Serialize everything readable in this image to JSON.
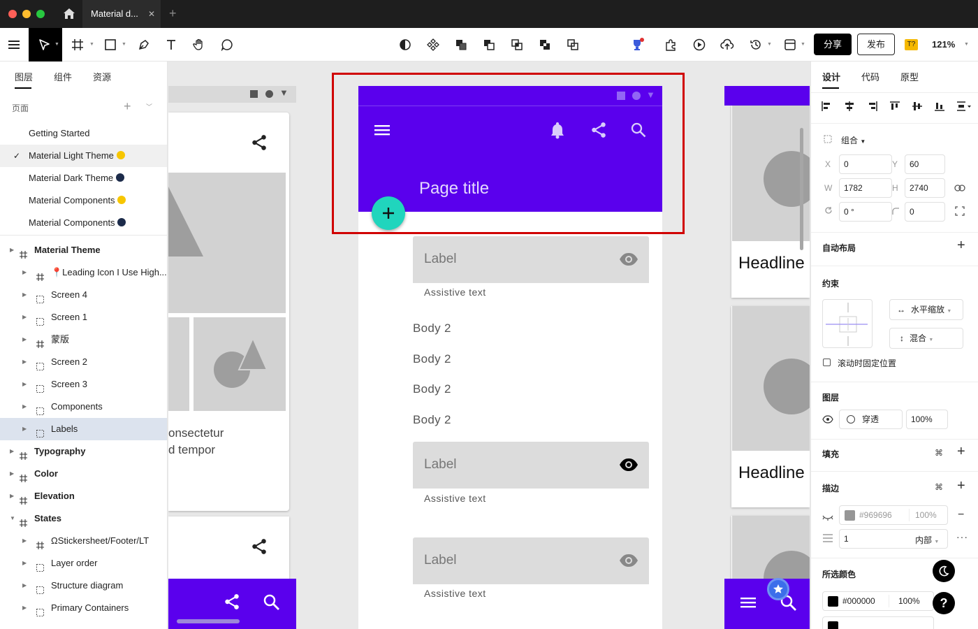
{
  "window": {
    "tab_title": "Material d...",
    "tab_close": "✕",
    "new_tab": "+"
  },
  "toolbar": {
    "share": "分享",
    "publish": "发布",
    "badge": "T?",
    "zoom": "121%"
  },
  "left_panel": {
    "tabs": [
      "图层",
      "组件",
      "资源"
    ],
    "pages_title": "页面",
    "pages": [
      {
        "label": "Getting Started",
        "selected": false
      },
      {
        "label": "Material Light Theme",
        "selected": true,
        "emoji": "🌕"
      },
      {
        "label": "Material Dark Theme",
        "selected": false,
        "emoji": "🌑"
      },
      {
        "label": "Material Components",
        "selected": false,
        "emoji": "🌕"
      },
      {
        "label": "Material Components",
        "selected": false,
        "emoji": "🌑"
      }
    ],
    "layers": [
      {
        "label": "Material Theme",
        "level": 0,
        "type": "frame",
        "bold": true
      },
      {
        "label": "📍Leading Icon I Use High...",
        "level": 1,
        "type": "frame"
      },
      {
        "label": "Screen 4",
        "level": 1,
        "type": "component"
      },
      {
        "label": "Screen 1",
        "level": 1,
        "type": "component"
      },
      {
        "label": "蒙版",
        "level": 1,
        "type": "frame"
      },
      {
        "label": "Screen 2",
        "level": 1,
        "type": "component"
      },
      {
        "label": "Screen 3",
        "level": 1,
        "type": "component"
      },
      {
        "label": "Components",
        "level": 1,
        "type": "component"
      },
      {
        "label": "Labels",
        "level": 1,
        "type": "component",
        "highlighted": true
      },
      {
        "label": "Typography",
        "level": 0,
        "type": "frame",
        "bold": true
      },
      {
        "label": "Color",
        "level": 0,
        "type": "frame",
        "bold": true
      },
      {
        "label": "Elevation",
        "level": 0,
        "type": "frame",
        "bold": true
      },
      {
        "label": "States",
        "level": 0,
        "type": "frame",
        "bold": true,
        "expanded": true
      },
      {
        "label": "ΩStickersheet/Footer/LT",
        "level": 1,
        "type": "frame"
      },
      {
        "label": "Layer order",
        "level": 1,
        "type": "component"
      },
      {
        "label": "Structure diagram",
        "level": 1,
        "type": "component"
      },
      {
        "label": "Primary Containers",
        "level": 1,
        "type": "component"
      }
    ]
  },
  "canvas": {
    "left_card_text": [
      "onsectetur",
      "d tempor"
    ],
    "center": {
      "page_title": "Page title",
      "fields": [
        {
          "label": "Label",
          "assistive": "Assistive text"
        },
        {
          "label": "Label",
          "assistive": "Assistive text"
        },
        {
          "label": "Label",
          "assistive": "Assistive text"
        }
      ],
      "body": [
        "Body 2",
        "Body 2",
        "Body 2",
        "Body 2"
      ]
    },
    "right_headlines": [
      "Headline",
      "Headline"
    ],
    "colors": {
      "primary": "#5a00ed",
      "fab": "#20d5bd",
      "selection": "#d00000"
    }
  },
  "right_panel": {
    "tabs": [
      "设计",
      "代码",
      "原型"
    ],
    "group_label": "组合",
    "x_label": "X",
    "x": "0",
    "y_label": "Y",
    "y": "60",
    "w_label": "W",
    "w": "1782",
    "h_label": "H",
    "h": "2740",
    "rotation": "0 °",
    "radius": "0",
    "auto_layout": "自动布局",
    "constraints": "约束",
    "h_constraint": "水平缩放",
    "v_constraint": "混合",
    "fix_on_scroll": "滚动时固定位置",
    "layer": "图层",
    "blend": "穿透",
    "opacity": "100%",
    "fill": "填充",
    "stroke": "描边",
    "stroke_color": "#969696",
    "stroke_opacity": "100%",
    "stroke_width": "1",
    "stroke_position": "内部",
    "selected_colors": "所选颜色",
    "color1": "#000000",
    "color1_opacity": "100%",
    "help": "?"
  }
}
